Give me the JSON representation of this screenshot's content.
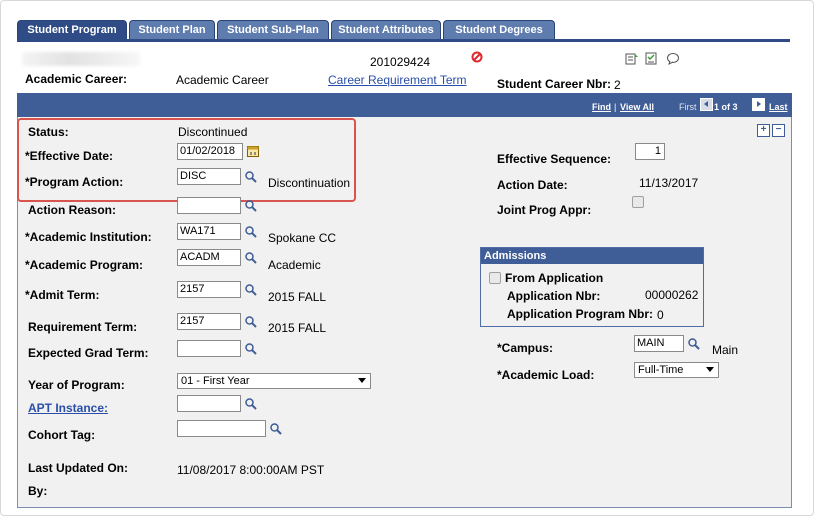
{
  "tabs": [
    "Student Program",
    "Student Plan",
    "Student Sub-Plan",
    "Student Attributes",
    "Student Degrees"
  ],
  "header": {
    "student_id": "201029424",
    "academic_career_label": "Academic Career:",
    "academic_career_value": "Academic Career",
    "career_requirement_link": "Career Requirement Term",
    "student_career_nbr_label": "Student Career Nbr:",
    "student_career_nbr_value": "2"
  },
  "nav": {
    "find": "Find",
    "sep": "|",
    "view_all": "View All",
    "first": "First",
    "range": "1 of 3",
    "last": "Last"
  },
  "form": {
    "status_label": "Status:",
    "status_value": "Discontinued",
    "effective_date_label": "*Effective Date:",
    "effective_date_value": "01/02/2018",
    "program_action_label": "*Program Action:",
    "program_action_value": "DISC",
    "program_action_desc": "Discontinuation",
    "action_reason_label": "Action Reason:",
    "action_reason_value": "",
    "institution_label": "*Academic Institution:",
    "institution_value": "WA171",
    "institution_desc": "Spokane CC",
    "program_label": "*Academic Program:",
    "program_value": "ACADM",
    "program_desc": "Academic",
    "admit_term_label": "*Admit Term:",
    "admit_term_value": "2157",
    "admit_term_desc": "2015 FALL",
    "req_term_label": "Requirement Term:",
    "req_term_value": "2157",
    "req_term_desc": "2015 FALL",
    "exp_grad_label": "Expected Grad Term:",
    "exp_grad_value": "",
    "year_label": "Year of Program:",
    "year_value": "01 - First Year",
    "apt_label": "APT Instance:",
    "apt_value": "",
    "cohort_label": "Cohort Tag:",
    "cohort_value": "",
    "updated_label": "Last Updated On:",
    "updated_value": "11/08/2017  8:00:00AM PST",
    "by_label": "By:"
  },
  "right": {
    "eff_seq_label": "Effective Sequence:",
    "eff_seq_value": "1",
    "action_date_label": "Action Date:",
    "action_date_value": "11/13/2017",
    "joint_label": "Joint Prog Appr:",
    "campus_label": "*Campus:",
    "campus_value": "MAIN",
    "campus_desc": "Main",
    "load_label": "*Academic Load:",
    "load_value": "Full-Time"
  },
  "admissions": {
    "title": "Admissions",
    "from_app_label": "From Application",
    "app_nbr_label": "Application Nbr:",
    "app_nbr_value": "00000262",
    "app_prog_label": "Application Program Nbr:",
    "app_prog_value": "0"
  },
  "colors": {
    "tab_active": "#2f4c86",
    "tab": "#5e7cae",
    "nav": "#3f5d96",
    "highlight": "#d9534f",
    "link": "#2a4fa8"
  }
}
